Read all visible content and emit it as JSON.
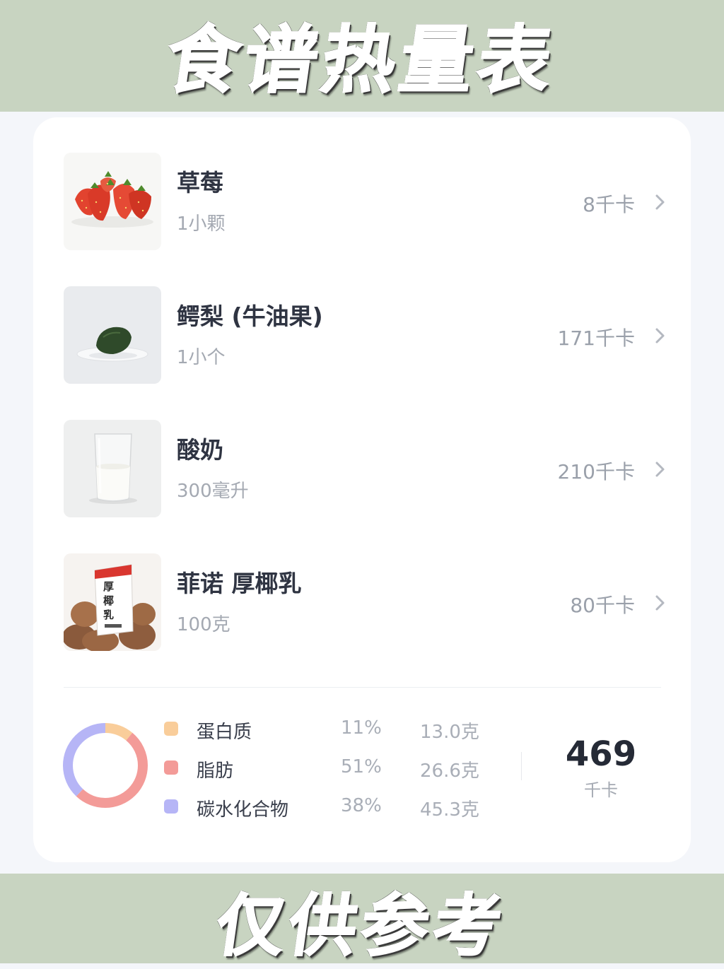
{
  "header": {
    "title": "食谱热量表"
  },
  "footer": {
    "title": "仅供参考"
  },
  "foods": [
    {
      "name": "草莓",
      "quantity": "1小颗",
      "kcal": "8千卡",
      "image_icon": "strawberry-image"
    },
    {
      "name": "鳄梨 (牛油果)",
      "quantity": "1小个",
      "kcal": "171千卡",
      "image_icon": "avocado-image"
    },
    {
      "name": "酸奶",
      "quantity": "300毫升",
      "kcal": "210千卡",
      "image_icon": "yogurt-image"
    },
    {
      "name": "菲诺 厚椰乳",
      "quantity": "100克",
      "kcal": "80千卡",
      "image_icon": "coconut-milk-image",
      "package_text": "厚椰乳"
    }
  ],
  "summary": {
    "macros": [
      {
        "name": "蛋白质",
        "percent": "11%",
        "grams": "13.0克",
        "color": "#f9cd9a",
        "share": 0.11
      },
      {
        "name": "脂肪",
        "percent": "51%",
        "grams": "26.6克",
        "color": "#f39b98",
        "share": 0.51
      },
      {
        "name": "碳水化合物",
        "percent": "38%",
        "grams": "45.3克",
        "color": "#b6b5f6",
        "share": 0.38
      }
    ],
    "total_kcal": "469",
    "total_unit": "千卡"
  },
  "colors": {
    "banner_bg": "#c8d4c1",
    "page_bg": "#f4f6fa",
    "card_bg": "#ffffff",
    "title_text": "#2f3442",
    "muted_text": "#a4a9b2"
  }
}
